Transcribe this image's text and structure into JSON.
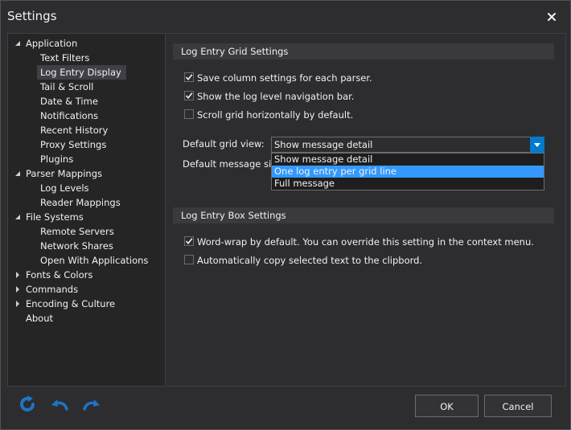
{
  "window": {
    "title": "Settings"
  },
  "nav": {
    "items": [
      {
        "label": "Application",
        "level": 0,
        "arrow": "expanded"
      },
      {
        "label": "Text Filters",
        "level": 1
      },
      {
        "label": "Log Entry Display",
        "level": 1,
        "selected": true
      },
      {
        "label": "Tail & Scroll",
        "level": 1
      },
      {
        "label": "Date & Time",
        "level": 1
      },
      {
        "label": "Notifications",
        "level": 1
      },
      {
        "label": "Recent History",
        "level": 1
      },
      {
        "label": "Proxy Settings",
        "level": 1
      },
      {
        "label": "Plugins",
        "level": 1
      },
      {
        "label": "Parser Mappings",
        "level": 0,
        "arrow": "expanded"
      },
      {
        "label": "Log Levels",
        "level": 1
      },
      {
        "label": "Reader Mappings",
        "level": 1
      },
      {
        "label": "File Systems",
        "level": 0,
        "arrow": "expanded"
      },
      {
        "label": "Remote Servers",
        "level": 1
      },
      {
        "label": "Network Shares",
        "level": 1
      },
      {
        "label": "Open With Applications",
        "level": 1
      },
      {
        "label": "Fonts & Colors",
        "level": 0,
        "arrow": "collapsed"
      },
      {
        "label": "Commands",
        "level": 0,
        "arrow": "collapsed"
      },
      {
        "label": "Encoding & Culture",
        "level": 0,
        "arrow": "collapsed"
      },
      {
        "label": "About",
        "level": 0
      }
    ]
  },
  "grid_settings": {
    "header": "Log Entry Grid Settings",
    "options": [
      {
        "label": "Save column settings for each parser.",
        "checked": true
      },
      {
        "label": "Show the log level navigation bar.",
        "checked": true
      },
      {
        "label": "Scroll grid horizontally by default.",
        "checked": false
      }
    ],
    "default_view_label": "Default grid view:",
    "default_view_value": "Show message detail",
    "default_size_label": "Default message size:",
    "dropdown_options": [
      "Show message detail",
      "One log entry per grid line",
      "Full message"
    ],
    "highlighted_option": 1
  },
  "box_settings": {
    "header": "Log Entry Box Settings",
    "options": [
      {
        "label": "Word-wrap by default.  You can override this setting in the context menu.",
        "checked": true
      },
      {
        "label": "Automatically copy selected text to the clipbord.",
        "checked": false
      }
    ]
  },
  "footer": {
    "ok_label": "OK",
    "cancel_label": "Cancel",
    "icons": [
      "refresh-icon",
      "undo-icon",
      "redo-icon"
    ]
  },
  "colors": {
    "accent": "#007acc",
    "highlight": "#3399ff",
    "icon_blue": "#1e73c8"
  }
}
